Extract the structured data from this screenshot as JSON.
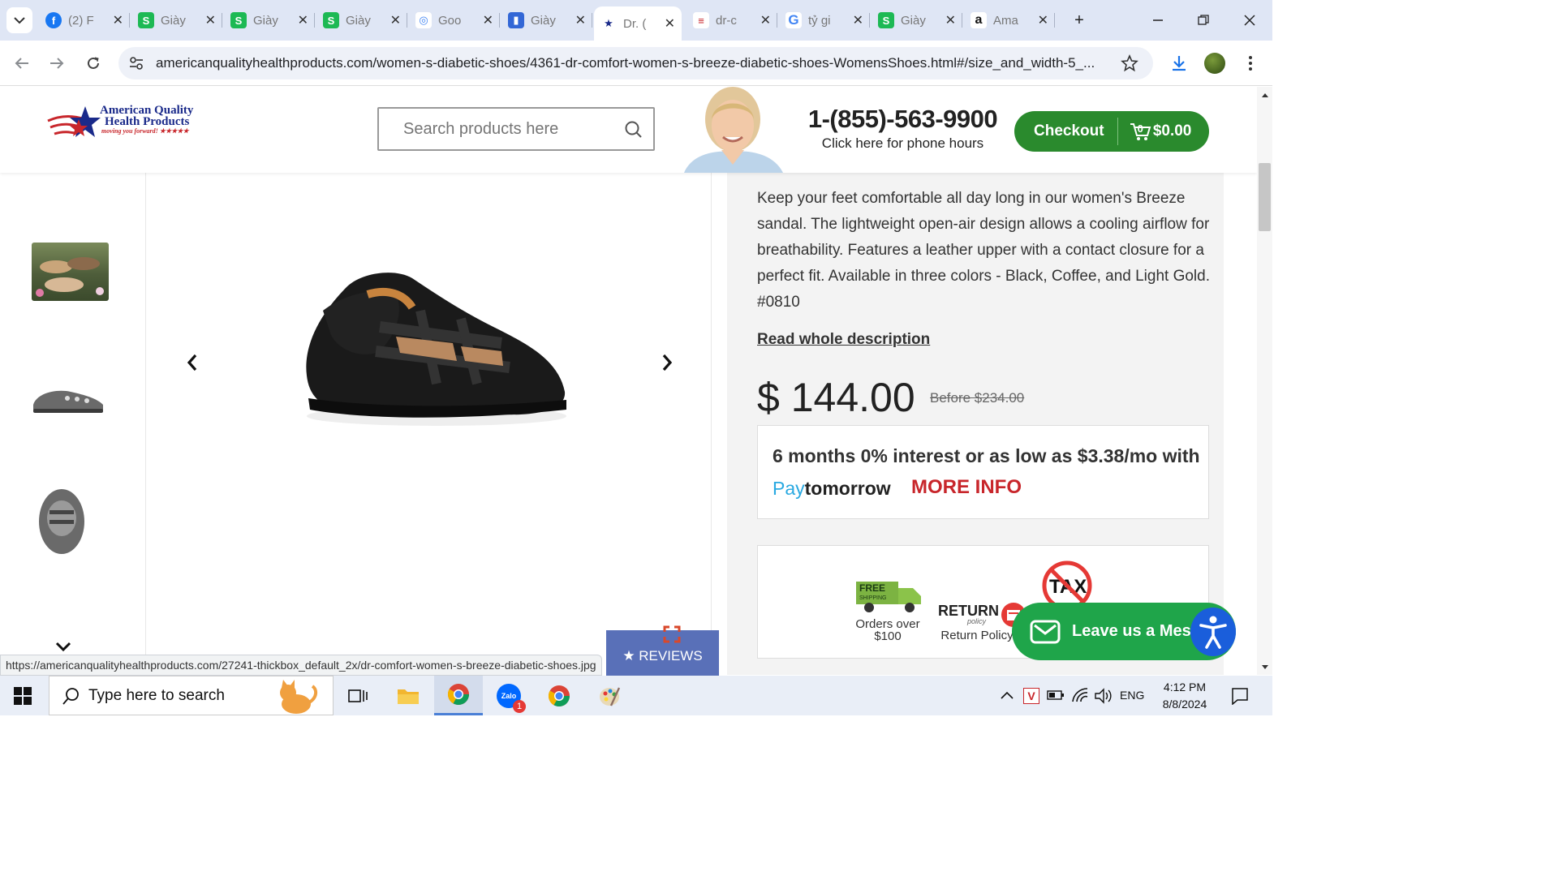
{
  "browser": {
    "tabs": [
      {
        "title": "(2) F",
        "icon": "facebook-icon",
        "color": "#1877f2"
      },
      {
        "title": "Giày",
        "icon": "s-app-icon",
        "color": "#1db954"
      },
      {
        "title": "Giày",
        "icon": "s-app-icon",
        "color": "#1db954"
      },
      {
        "title": "Giày",
        "icon": "s-app-icon",
        "color": "#1db954"
      },
      {
        "title": "Goo",
        "icon": "google-lens-icon",
        "color": "#4285f4"
      },
      {
        "title": "Giày",
        "icon": "doc-icon",
        "color": "#3367d6"
      },
      {
        "title": "Dr. (",
        "icon": "aqhp-icon",
        "color": "#c8262b",
        "active": true
      },
      {
        "title": "dr-c",
        "icon": "flag-icon",
        "color": "#c8262b"
      },
      {
        "title": "tỷ gi",
        "icon": "google-icon",
        "color": "#4285f4"
      },
      {
        "title": "Giày",
        "icon": "s-app-icon",
        "color": "#1db954"
      },
      {
        "title": "Ama",
        "icon": "amazon-icon",
        "color": "#111111"
      }
    ],
    "url": "americanqualityhealthproducts.com/women-s-diabetic-shoes/4361-dr-comfort-women-s-breeze-diabetic-shoes-WomensShoes.html#/size_and_width-5_...",
    "status_url": "https://americanqualityhealthproducts.com/27241-thickbox_default_2x/dr-comfort-women-s-breeze-diabetic-shoes.jpg"
  },
  "site": {
    "logo_line1": "American Quality",
    "logo_line2": "Health Products",
    "logo_tagline": "moving you forward! ★★★★★",
    "search_placeholder": "Search products here",
    "phone": "1-(855)-563-9900",
    "phone_sub": "Click here for phone hours",
    "checkout_label": "Checkout",
    "cart_count": "0",
    "cart_total": "$0.00"
  },
  "product": {
    "description": "Keep your feet comfortable all day long in our women's Breeze sandal. The lightweight open-air design allows a cooling airflow for breathability. Features a leather upper with a contact closure for a perfect fit. Available in three colors - Black, Coffee, and Light Gold. #0810",
    "read_more": "Read whole description",
    "price": "$ 144.00",
    "before_price": "Before $234.00",
    "finance_line": "6 months 0% interest  or as low as $3.38/mo with",
    "paytomorrow_pay": "Pay",
    "paytomorrow_rest": "tomorrow",
    "more_info": "MORE INFO",
    "badges": {
      "free_shipping_top": "FREE",
      "free_shipping_sub": "SHIPPING",
      "orders_over": "Orders over",
      "orders_amount": "$100",
      "return_word": "RETURN",
      "return_policy_small": "policy",
      "return_label": "Return Policy",
      "tax_word": "TAX"
    },
    "reviews_label": "★ REVIEWS",
    "messenger_label": "Leave us a Mess"
  },
  "taskbar": {
    "search_placeholder": "Type here to search",
    "language": "ENG",
    "time": "4:12 PM",
    "date": "8/8/2024",
    "zalo_badge": "1"
  }
}
